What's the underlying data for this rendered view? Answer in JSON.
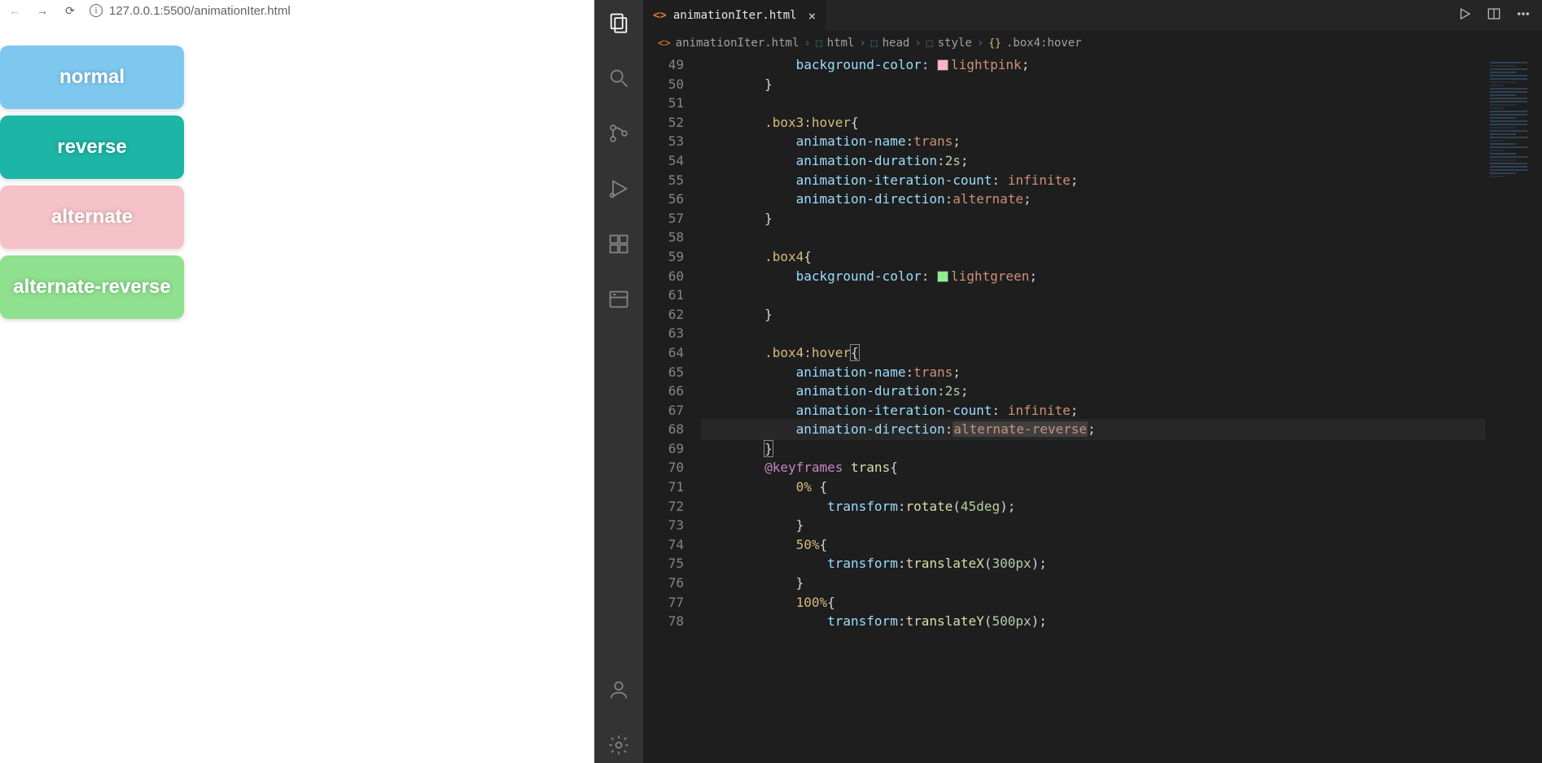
{
  "browser": {
    "url_display": "127.0.0.1:5500/animationIter.html",
    "boxes": [
      {
        "label": "normal"
      },
      {
        "label": "reverse"
      },
      {
        "label": "alternate"
      },
      {
        "label": "alternate-reverse"
      }
    ]
  },
  "vscode": {
    "tab": {
      "filename": "animationIter.html"
    },
    "breadcrumbs": [
      {
        "label": "animationIter.html",
        "icon": "file-html"
      },
      {
        "label": "html",
        "icon": "cube"
      },
      {
        "label": "head",
        "icon": "cube"
      },
      {
        "label": "style",
        "icon": "cube"
      },
      {
        "label": ".box4:hover",
        "icon": "brackets"
      }
    ],
    "first_line_number": 49,
    "line_numbers": [
      "49",
      "50",
      "51",
      "52",
      "53",
      "54",
      "55",
      "56",
      "57",
      "58",
      "59",
      "60",
      "61",
      "62",
      "63",
      "64",
      "65",
      "66",
      "67",
      "68",
      "69",
      "70",
      "71",
      "72",
      "73",
      "74",
      "75",
      "76",
      "77",
      "78"
    ],
    "current_line_index": 19,
    "code_lines_raw": [
      "            background-color: lightpink;",
      "        }",
      "",
      "        .box3:hover{",
      "            animation-name:trans;",
      "            animation-duration:2s;",
      "            animation-iteration-count: infinite;",
      "            animation-direction:alternate;",
      "        }",
      "",
      "        .box4{",
      "            background-color: lightgreen;",
      "",
      "        }",
      "",
      "        .box4:hover{",
      "            animation-name:trans;",
      "            animation-duration:2s;",
      "            animation-iteration-count: infinite;",
      "            animation-direction:alternate-reverse;",
      "        }",
      "        @keyframes trans{",
      "            0% {",
      "                transform:rotate(45deg);",
      "            }",
      "            50%{",
      "                transform:translateX(300px);",
      "            }",
      "            100%{",
      "                transform:translateY(500px);"
    ]
  }
}
